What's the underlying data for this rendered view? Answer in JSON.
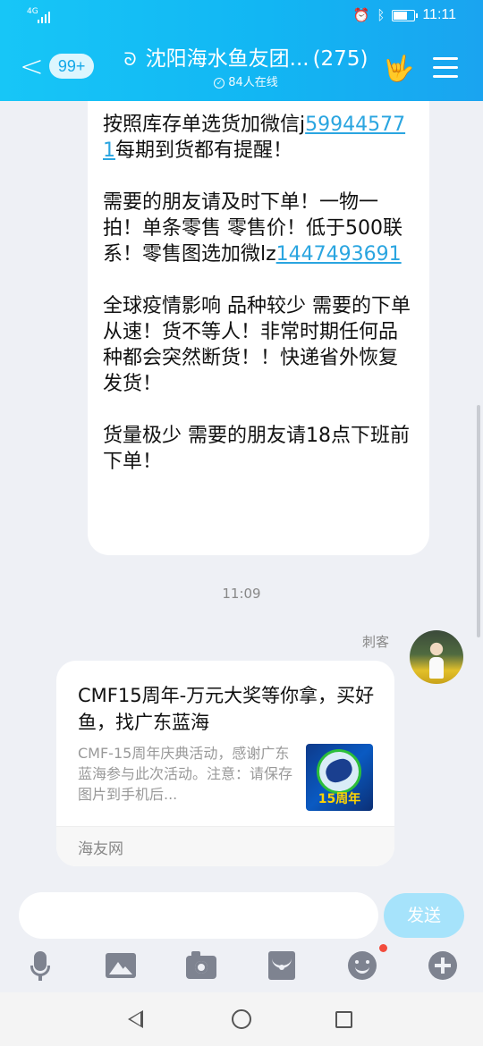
{
  "status_bar": {
    "network": "4G",
    "time": "11:11"
  },
  "header": {
    "unread_count": "99+",
    "title": "沈阳海水鱼友团...",
    "member_count": "(275)",
    "online_text": "84人在线"
  },
  "messages": {
    "text_message": {
      "p1_text": "按照库存单选货加微信j",
      "p1_link": "599445771",
      "p1_tail": "每期到货都有提醒！",
      "p2_text": "需要的朋友请及时下单！一物一拍！单条零售 零售价！低于500联系！零售图选加微lz",
      "p2_link": "1447493691",
      "p3": "全球疫情影响 品种较少 需要的下单从速！货不等人！非常时期任何品种都会突然断货！！快递省外恢复发货！",
      "p4": "货量极少 需要的朋友请18点下班前下单！"
    },
    "timestamp": "11:09",
    "card_message": {
      "sender": "刺客",
      "title": "CMF15周年-万元大奖等你拿，买好鱼，找广东蓝海",
      "description": "CMF-15周年庆典活动，感谢广东蓝海参与此次活动。注意：请保存图片到手机后...",
      "thumb_text": "15周年",
      "source": "海友网"
    }
  },
  "input": {
    "placeholder": "",
    "send_label": "发送"
  },
  "toolbar": {
    "icons": [
      "microphone-icon",
      "image-icon",
      "camera-icon",
      "red-packet-icon",
      "emoji-icon",
      "plus-icon"
    ],
    "emoji_has_notification": true
  },
  "colors": {
    "header_blue": "#12b6f3",
    "link": "#2aa5e0",
    "send_button": "#a6e3fb",
    "notification": "#f24c3d"
  }
}
